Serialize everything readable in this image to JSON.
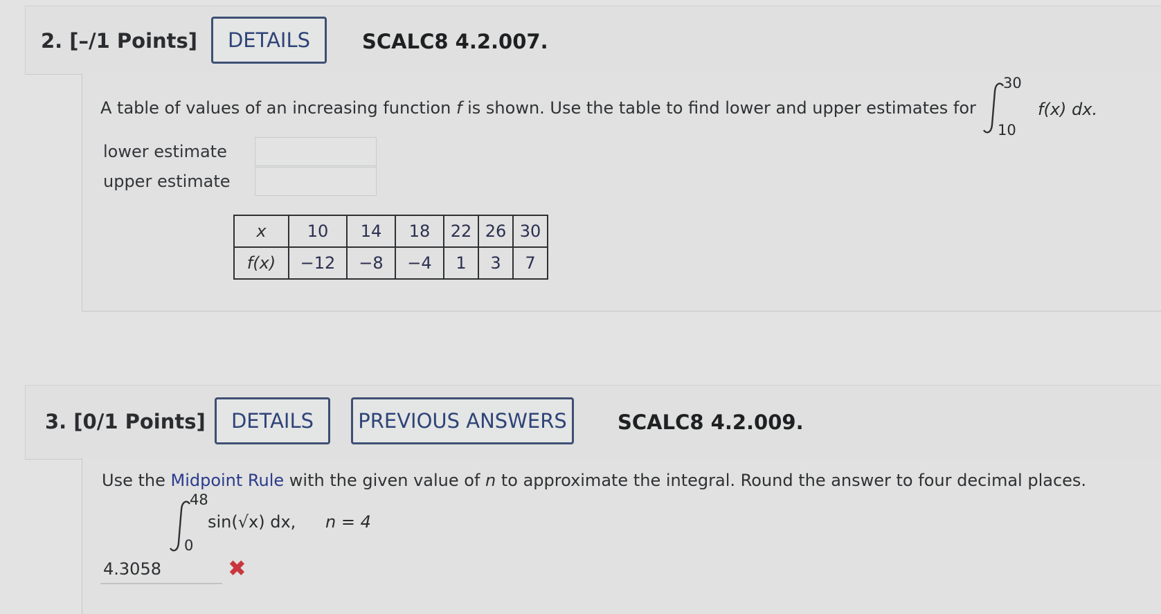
{
  "q2": {
    "number": "2.  [–/1 Points]",
    "details_label": "DETAILS",
    "ref": "SCALC8 4.2.007.",
    "prompt_pre": "A table of values of an increasing function ",
    "prompt_f": "f",
    "prompt_post": " is shown. Use the table to find lower and upper estimates for",
    "integral_upper": "30",
    "integral_lower": "10",
    "integrand": "f(x) dx.",
    "lower_label": "lower estimate",
    "upper_label": "upper estimate",
    "table": {
      "x_header": "x",
      "fx_header": "f(x)",
      "x_values": [
        "10",
        "14",
        "18",
        "22",
        "26",
        "30"
      ],
      "fx_values": [
        "−12",
        "−8",
        "−4",
        "1",
        "3",
        "7"
      ]
    }
  },
  "q3": {
    "number": "3.  [0/1 Points]",
    "details_label": "DETAILS",
    "prev_label": "PREVIOUS ANSWERS",
    "ref": "SCALC8 4.2.009.",
    "prompt_pre": "Use the ",
    "prompt_link": "Midpoint Rule",
    "prompt_mid": " with the given value of ",
    "prompt_n": "n",
    "prompt_post": " to approximate the integral. Round the answer to four decimal places.",
    "integral_upper": "48",
    "integral_lower": "0",
    "integrand": "sin(√x) dx,",
    "n_label": "n = 4",
    "answer_value": "4.3058",
    "status_icon": "incorrect-x-icon"
  },
  "colors": {
    "button_text": "#2e4478",
    "link": "#2c3a8c",
    "incorrect": "#c8373d"
  }
}
